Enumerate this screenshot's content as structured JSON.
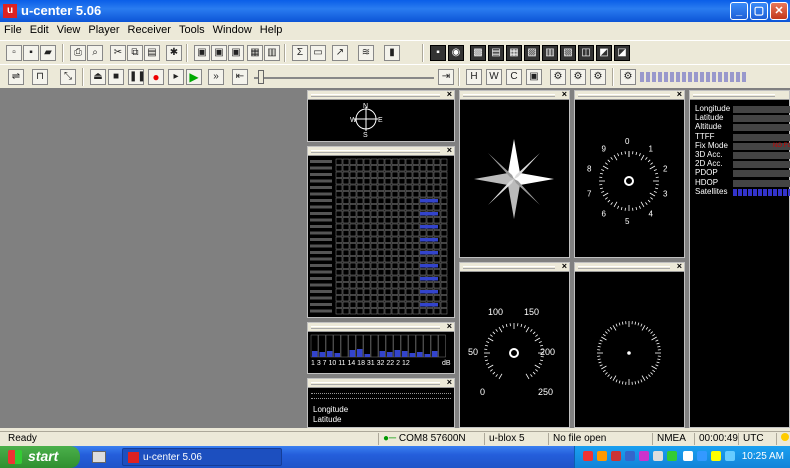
{
  "window": {
    "title": "u-center 5.06",
    "app_icon_letter": "u"
  },
  "menu": [
    "File",
    "Edit",
    "View",
    "Player",
    "Receiver",
    "Tools",
    "Window",
    "Help"
  ],
  "compass_panel": {
    "n": "N",
    "s": "S",
    "e": "E",
    "w": "W"
  },
  "skyview_panel": {
    "labels": [
      {
        "text": "0"
      },
      {
        "text": "1"
      },
      {
        "text": "2"
      },
      {
        "text": "3"
      },
      {
        "text": "4"
      },
      {
        "text": "5"
      },
      {
        "text": "6"
      },
      {
        "text": "7"
      },
      {
        "text": "8"
      },
      {
        "text": "9"
      }
    ]
  },
  "speed_panel": {
    "labels": [
      {
        "text": "100"
      },
      {
        "text": "150"
      },
      {
        "text": "50"
      },
      {
        "text": "200"
      },
      {
        "text": "0"
      },
      {
        "text": "250"
      }
    ]
  },
  "data_panel": {
    "rows": [
      {
        "label": "Longitude",
        "value": ""
      },
      {
        "label": "Latitude",
        "value": ""
      },
      {
        "label": "Altitude",
        "value": ""
      },
      {
        "label": "TTFF",
        "value": ""
      },
      {
        "label": "Fix Mode",
        "value": "NO FIX"
      },
      {
        "label": "3D Acc.",
        "value": ""
      },
      {
        "label": "2D Acc.",
        "value": ""
      },
      {
        "label": "PDOP",
        "value": ""
      },
      {
        "label": "HDOP",
        "value": ""
      },
      {
        "label": "Satellites",
        "value": ""
      }
    ],
    "fix_color": "#cc0000"
  },
  "sat_strip": {
    "labels": "1  3  7 10 11 14 18 31 32 22 2  12",
    "unit": "dB"
  },
  "lonlat_panel": {
    "longitude": "Longitude",
    "latitude": "Latitude"
  },
  "status_bar": {
    "ready": "Ready",
    "port": "COM8 57600N",
    "receiver": "u-blox 5",
    "file": "No file open",
    "protocol": "NMEA",
    "time": "00:00:49",
    "tz": "UTC"
  },
  "taskbar": {
    "start": "start",
    "task": "u-center 5.06",
    "clock": "10:25 AM"
  },
  "colors": {
    "titlebar": "#0a5ee8",
    "panel_bg": "#000000",
    "workspace": "#808080",
    "bar_blue": "#3344cc"
  }
}
